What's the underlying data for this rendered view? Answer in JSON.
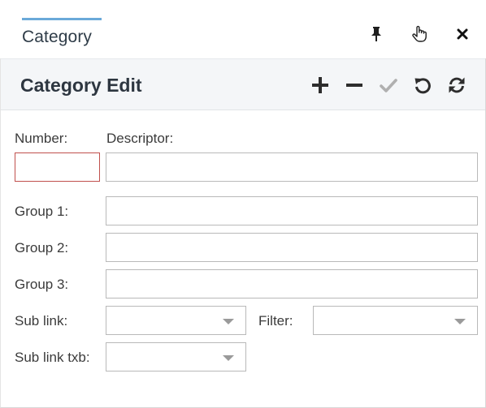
{
  "tab": {
    "title": "Category",
    "actions": [
      {
        "name": "pin-icon"
      },
      {
        "name": "hand-pointer-icon"
      },
      {
        "name": "close-icon"
      }
    ]
  },
  "section": {
    "title": "Category Edit",
    "toolbar": [
      {
        "name": "add-icon",
        "enabled": true
      },
      {
        "name": "remove-icon",
        "enabled": true
      },
      {
        "name": "check-icon",
        "enabled": false
      },
      {
        "name": "undo-icon",
        "enabled": true
      },
      {
        "name": "refresh-icon",
        "enabled": true
      }
    ]
  },
  "form": {
    "number": {
      "label": "Number:",
      "value": ""
    },
    "descriptor": {
      "label": "Descriptor:",
      "value": ""
    },
    "group1": {
      "label": "Group 1:",
      "value": ""
    },
    "group2": {
      "label": "Group 2:",
      "value": ""
    },
    "group3": {
      "label": "Group 3:",
      "value": ""
    },
    "sub_link": {
      "label": "Sub link:",
      "value": ""
    },
    "filter": {
      "label": "Filter:",
      "value": ""
    },
    "sub_link_txb": {
      "label": "Sub link txb:",
      "value": ""
    }
  },
  "colors": {
    "tab_accent": "#6aa9d9",
    "header_bg": "#f4f6f8",
    "invalid_border": "#c0504d",
    "icon_dark": "#2d2d2d",
    "icon_disabled": "#b0b0b0"
  }
}
